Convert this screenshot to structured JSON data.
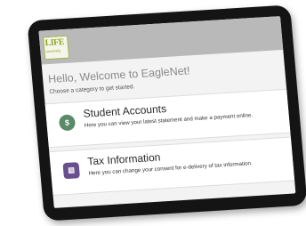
{
  "header": {
    "logo_main": "LIFE",
    "logo_sub": "university"
  },
  "welcome": {
    "title": "Hello, Welcome to EagleNet!",
    "subtitle": "Choose a category to get started."
  },
  "categories": [
    {
      "title": "Student Accounts",
      "description": "Here you can view your latest statement and make a payment online.",
      "icon": "dollar-icon"
    },
    {
      "title": "Tax Information",
      "description": "Here you can change your consent for e-delivery of tax information.",
      "icon": "document-icon"
    }
  ],
  "colors": {
    "brand_green": "#8ba520",
    "topbar": "#b9b9b9",
    "student_icon": "#5a8a68",
    "tax_icon": "#6a4f8f"
  }
}
